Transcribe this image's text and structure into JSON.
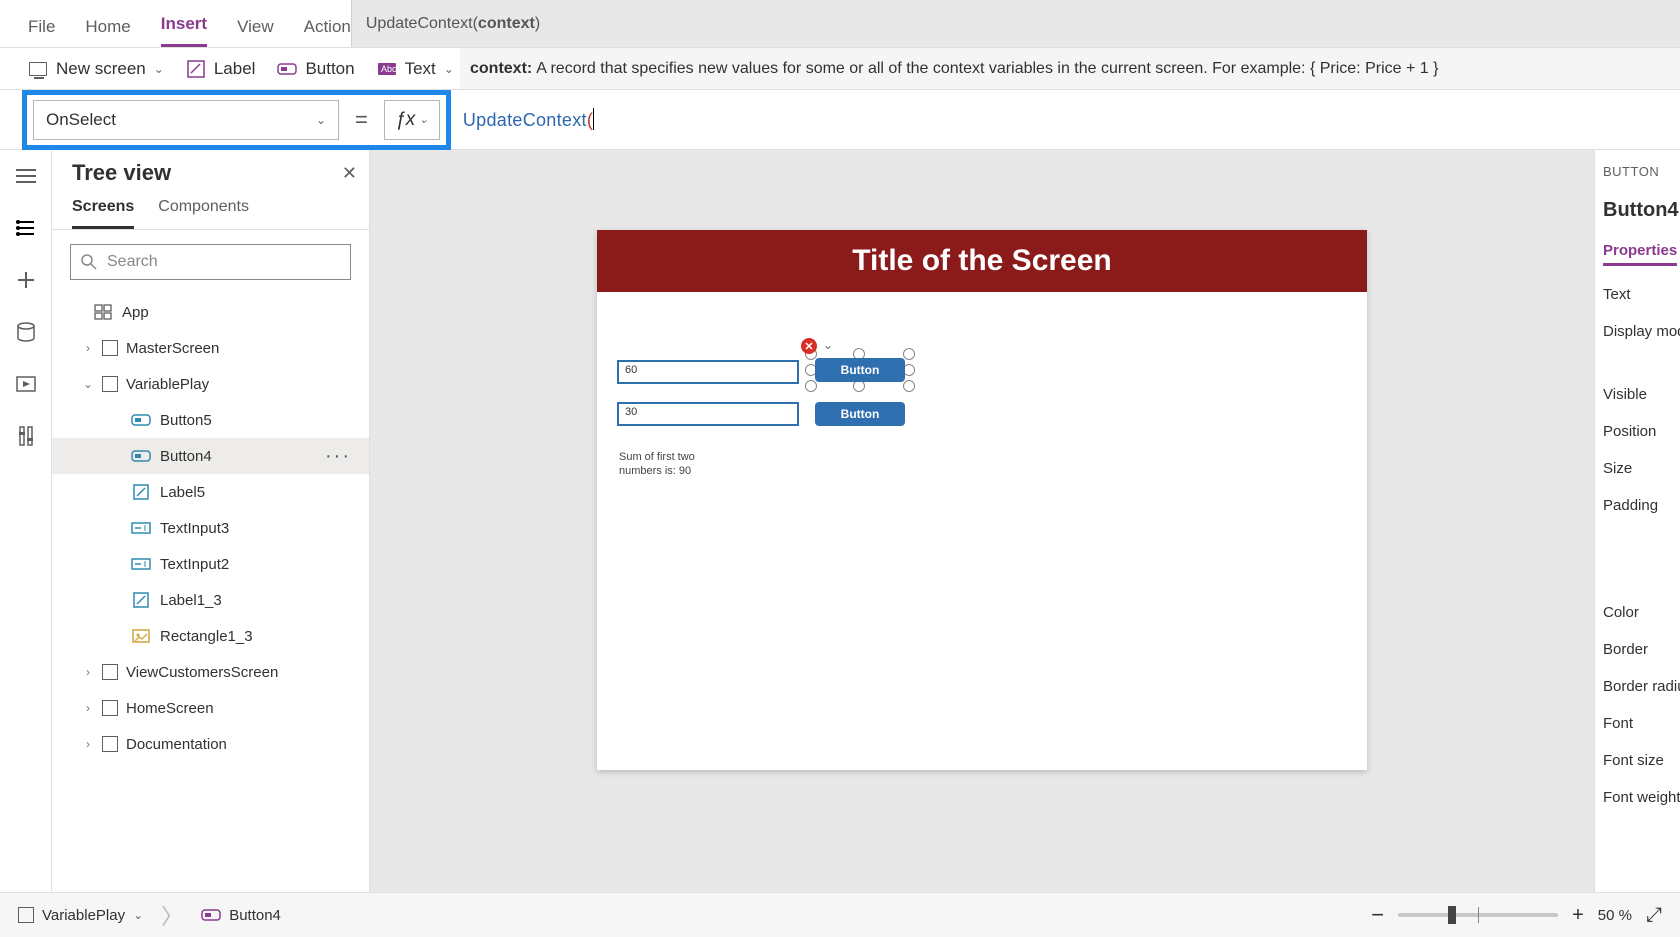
{
  "menu": {
    "file": "File",
    "home": "Home",
    "insert": "Insert",
    "view": "View",
    "action": "Action",
    "active": "insert"
  },
  "signature": {
    "fn": "UpdateContext",
    "paren_open": "(",
    "bold": "context",
    "paren_close": ")"
  },
  "toolbar": {
    "newscreen": "New screen",
    "label": "Label",
    "button": "Button",
    "text": "Text"
  },
  "hint": {
    "key": "context:",
    "body": "A record that specifies new values for some or all of the context variables in the current screen. For example: { Price: Price + 1 }"
  },
  "formulaBar": {
    "property": "OnSelect",
    "fn": "UpdateContext",
    "paren": "("
  },
  "treePanel": {
    "title": "Tree view",
    "tabs": {
      "screens": "Screens",
      "components": "Components"
    },
    "search_placeholder": "Search",
    "items": [
      {
        "level": 0,
        "icon": "app",
        "label": "App",
        "chev": "",
        "box": false
      },
      {
        "level": 1,
        "icon": "screen",
        "label": "MasterScreen",
        "chev": ">",
        "box": true
      },
      {
        "level": 1,
        "icon": "screen",
        "label": "VariablePlay",
        "chev": "v",
        "box": true
      },
      {
        "level": 2,
        "icon": "button",
        "label": "Button5",
        "chev": "",
        "box": false
      },
      {
        "level": 2,
        "icon": "button",
        "label": "Button4",
        "chev": "",
        "box": false,
        "selected": true
      },
      {
        "level": 2,
        "icon": "label",
        "label": "Label5",
        "chev": "",
        "box": false
      },
      {
        "level": 2,
        "icon": "input",
        "label": "TextInput3",
        "chev": "",
        "box": false
      },
      {
        "level": 2,
        "icon": "input",
        "label": "TextInput2",
        "chev": "",
        "box": false
      },
      {
        "level": 2,
        "icon": "label",
        "label": "Label1_3",
        "chev": "",
        "box": false
      },
      {
        "level": 2,
        "icon": "rect",
        "label": "Rectangle1_3",
        "chev": "",
        "box": false
      },
      {
        "level": 1,
        "icon": "screen",
        "label": "ViewCustomersScreen",
        "chev": ">",
        "box": true
      },
      {
        "level": 1,
        "icon": "screen",
        "label": "HomeScreen",
        "chev": ">",
        "box": true
      },
      {
        "level": 1,
        "icon": "screen",
        "label": "Documentation",
        "chev": ">",
        "box": true
      }
    ]
  },
  "canvas": {
    "title": "Title of the Screen",
    "input1": "60",
    "input2": "30",
    "button1": "Button",
    "button2": "Button",
    "sum_line1": "Sum of first two",
    "sum_line2": "numbers is: 90"
  },
  "propsPanel": {
    "category": "BUTTON",
    "name": "Button4",
    "tab": "Properties",
    "rows": [
      "Text",
      "Display mod",
      "Visible",
      "Position",
      "Size",
      "Padding",
      "Color",
      "Border",
      "Border radiu",
      "Font",
      "Font size",
      "Font weight"
    ]
  },
  "statusBar": {
    "screen": "VariablePlay",
    "control": "Button4",
    "zoom": "50 %",
    "minus": "−",
    "plus": "+"
  }
}
